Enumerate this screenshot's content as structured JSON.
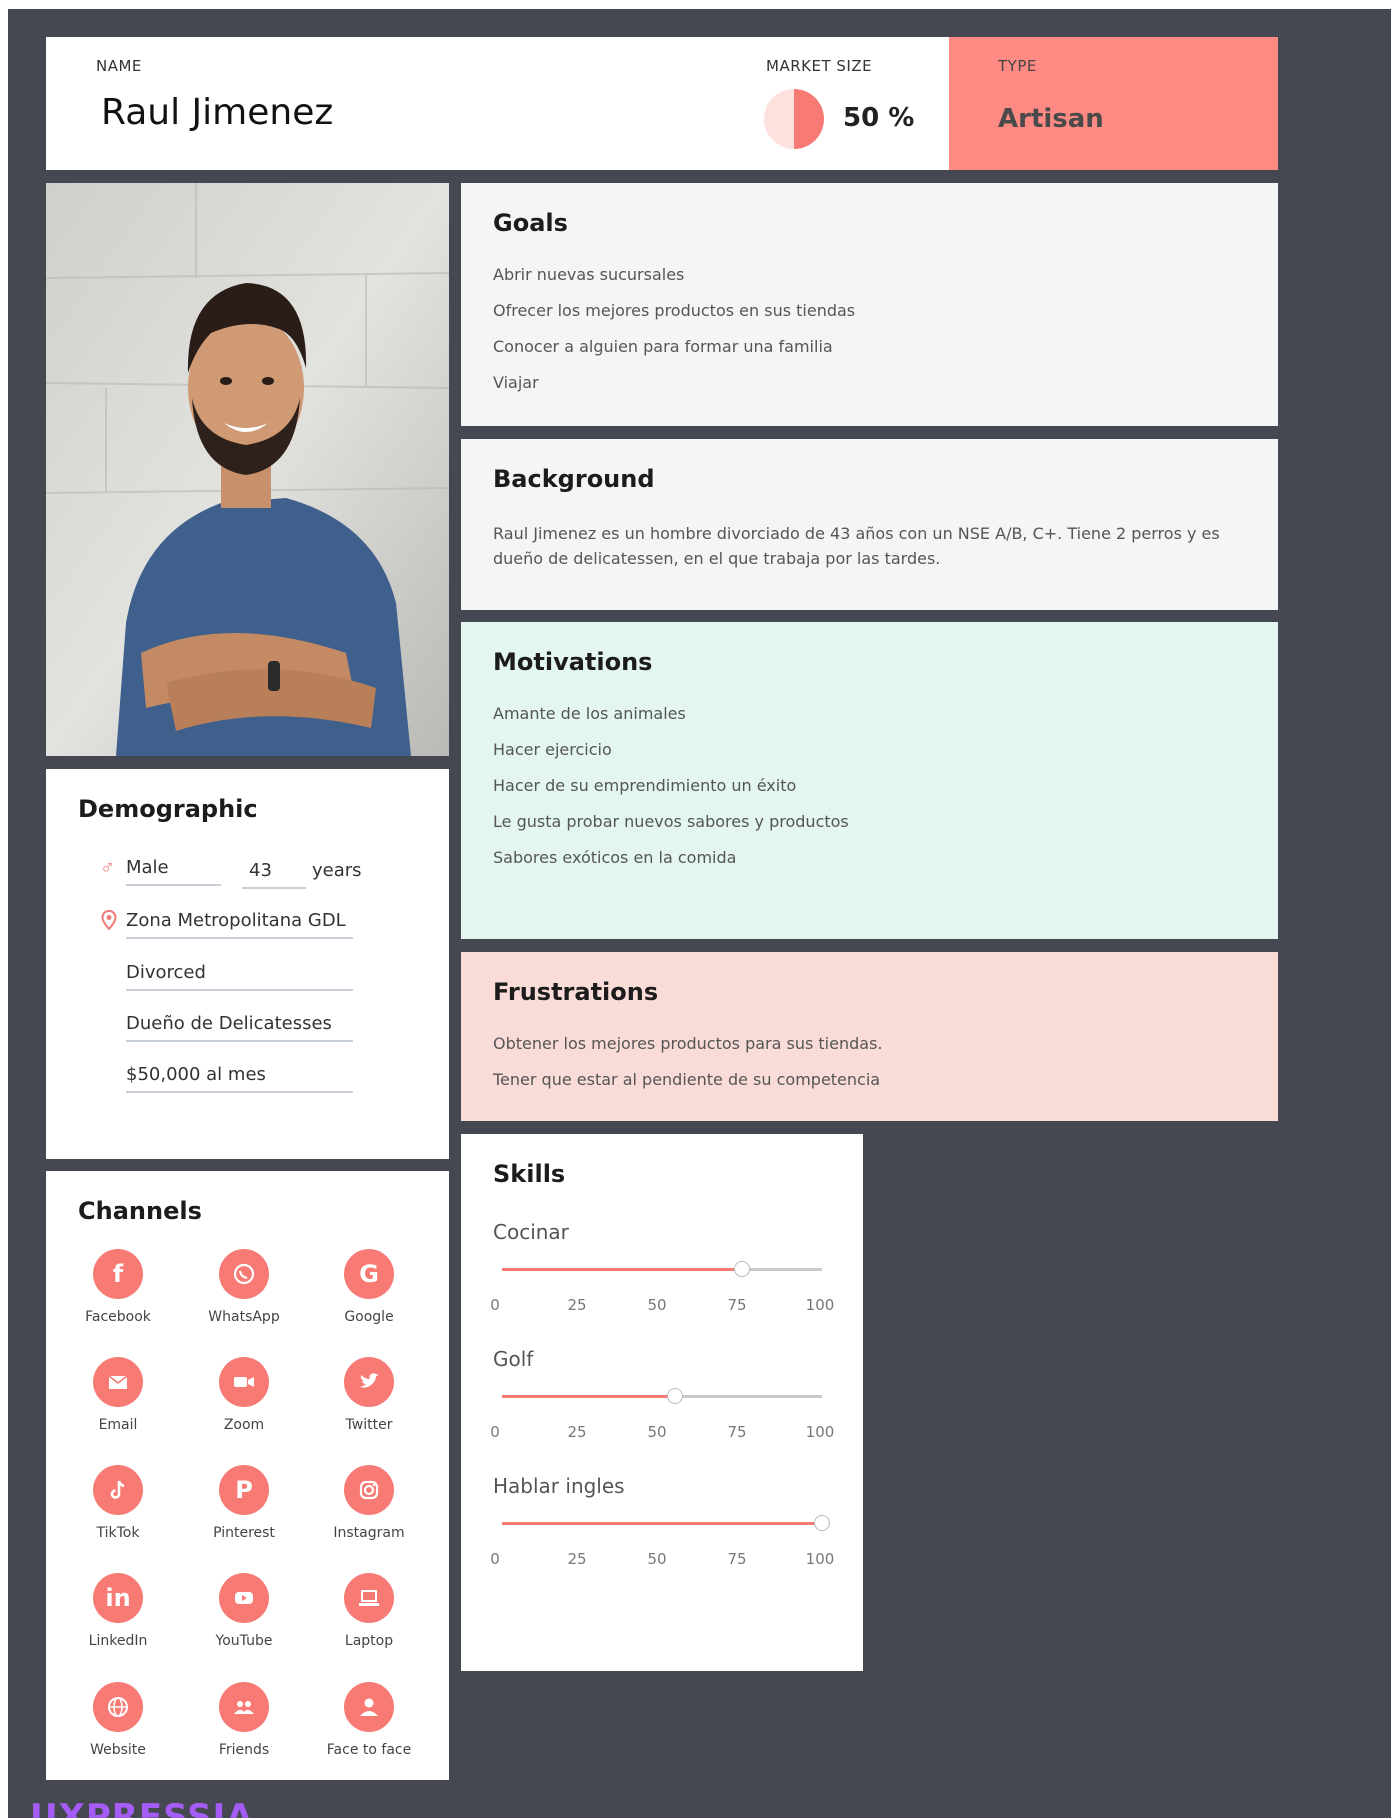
{
  "header": {
    "name_label": "NAME",
    "name": "Raul Jimenez",
    "market_size_label": "MARKET SIZE",
    "market_size_value": "50 %",
    "market_size_fraction": 0.5,
    "type_label": "TYPE",
    "type_value": "Artisan"
  },
  "colors": {
    "accent": "#f87a74",
    "type_bg": "#ff8a84",
    "motivations_bg": "#e3f6f1",
    "frustrations_bg": "#f9dcd8",
    "canvas_bg": "#454851",
    "brand": "#a55cf6"
  },
  "goals": {
    "title": "Goals",
    "items": [
      "Abrir nuevas sucursales",
      "Ofrecer los mejores productos en sus tiendas",
      "Conocer a alguien para formar una familia",
      "Viajar"
    ]
  },
  "background": {
    "title": "Background",
    "text": "Raul Jimenez es un hombre divorciado de 43 años con un NSE A/B, C+. Tiene 2 perros y es dueño de delicatessen, en el que trabaja por las tardes."
  },
  "motivations": {
    "title": "Motivations",
    "items": [
      "Amante de los animales",
      "Hacer ejercicio",
      "Hacer de su emprendimiento un éxito",
      "Le gusta probar nuevos sabores y productos",
      "Sabores exóticos en la comida"
    ]
  },
  "frustrations": {
    "title": "Frustrations",
    "items": [
      "Obtener los mejores productos para sus tiendas.",
      "Tener que estar al pendiente de su competencia"
    ]
  },
  "demographic": {
    "title": "Demographic",
    "gender": "Male",
    "gender_icon": "male-icon",
    "age": "43",
    "age_unit": "years",
    "location": "Zona Metropolitana GDL",
    "location_icon": "location-pin-icon",
    "marital_status": "Divorced",
    "occupation": "Dueño de Delicatesses",
    "income": "$50,000 al mes"
  },
  "channels": {
    "title": "Channels",
    "items": [
      {
        "label": "Facebook",
        "icon": "facebook-icon",
        "glyph": "f"
      },
      {
        "label": "WhatsApp",
        "icon": "whatsapp-icon",
        "glyph": ""
      },
      {
        "label": "Google",
        "icon": "google-icon",
        "glyph": "G"
      },
      {
        "label": "Email",
        "icon": "email-icon",
        "glyph": ""
      },
      {
        "label": "Zoom",
        "icon": "zoom-icon",
        "glyph": ""
      },
      {
        "label": "Twitter",
        "icon": "twitter-icon",
        "glyph": ""
      },
      {
        "label": "TikTok",
        "icon": "tiktok-icon",
        "glyph": ""
      },
      {
        "label": "Pinterest",
        "icon": "pinterest-icon",
        "glyph": "P"
      },
      {
        "label": "Instagram",
        "icon": "instagram-icon",
        "glyph": ""
      },
      {
        "label": "LinkedIn",
        "icon": "linkedin-icon",
        "glyph": "in"
      },
      {
        "label": "YouTube",
        "icon": "youtube-icon",
        "glyph": ""
      },
      {
        "label": "Laptop",
        "icon": "laptop-icon",
        "glyph": ""
      },
      {
        "label": "Website",
        "icon": "globe-icon",
        "glyph": ""
      },
      {
        "label": "Friends",
        "icon": "friends-icon",
        "glyph": ""
      },
      {
        "label": "Face to face",
        "icon": "person-icon",
        "glyph": ""
      }
    ]
  },
  "skills": {
    "title": "Skills",
    "ticks": [
      "0",
      "25",
      "50",
      "75",
      "100"
    ],
    "items": [
      {
        "name": "Cocinar",
        "value": 75
      },
      {
        "name": "Golf",
        "value": 54
      },
      {
        "name": "Hablar ingles",
        "value": 100
      }
    ]
  },
  "brand": {
    "name": "UXPRESSIA"
  }
}
